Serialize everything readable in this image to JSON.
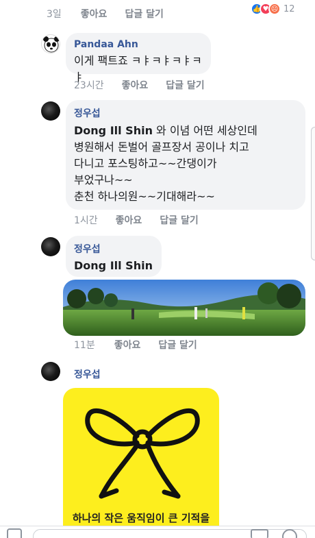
{
  "comment0": {
    "time": "3일",
    "like": "좋아요",
    "reply": "답글 달기",
    "reaction_count": "12",
    "reaction_icons": [
      "like-icon",
      "love-icon",
      "angry-icon"
    ]
  },
  "comment1": {
    "author": "Pandaa Ahn",
    "text": "이게 팩트죠 ㅋㅑㅋㅑㅋㅑㅋㅑ",
    "time": "23시간",
    "like": "좋아요",
    "reply": "답글 달기"
  },
  "comment2": {
    "author": "정우섭",
    "tag": "Dong Ill Shin",
    "text_first": " 와 이념 어떤 세상인데",
    "text_rest": "병원해서 돈벌어 골프장서 공이나 치고\n다니고 포스팅하고~~간댕이가\n부었구나~~\n춘천 하나의원~~기대해라~~",
    "time": "1시간",
    "like": "좋아요",
    "reply": "답글 달기"
  },
  "comment3": {
    "author": "정우섭",
    "tag": "Dong Ill Shin",
    "time": "11분",
    "like": "좋아요",
    "reply": "답글 달기"
  },
  "comment4": {
    "author": "정우섭",
    "image_caption": "하나의 작은 움직임이 큰 기적을"
  },
  "colors": {
    "link_blue": "#385898",
    "bubble_gray": "#f2f3f5",
    "meta_gray": "#8d949e",
    "ribbon_yellow": "#fdee1e",
    "like_blue": "#1877f2",
    "love_red": "#f33e58",
    "angry_orange": "#f7714c"
  }
}
